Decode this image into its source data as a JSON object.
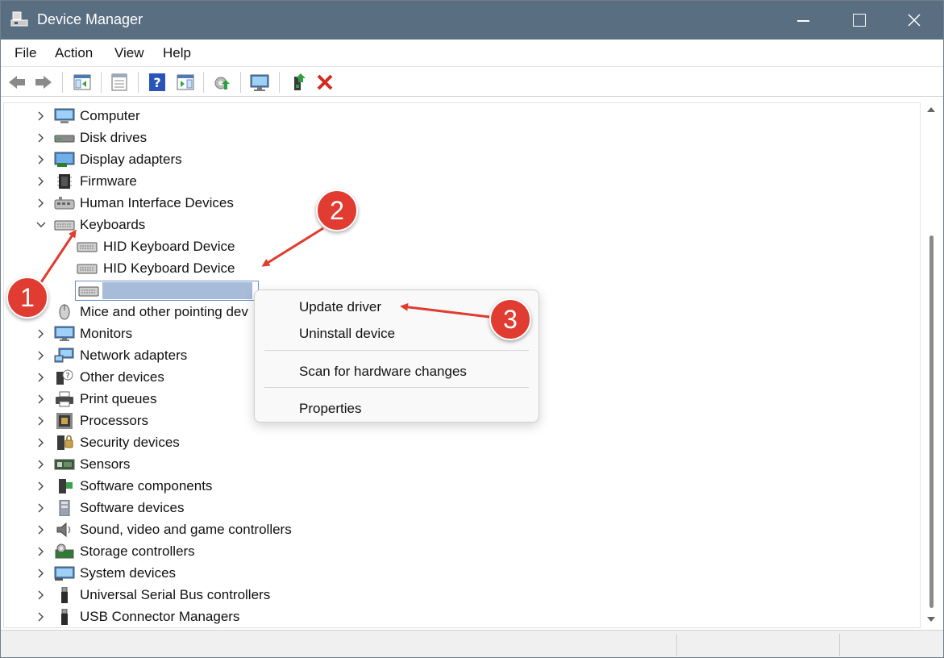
{
  "window": {
    "title": "Device Manager"
  },
  "menu": [
    "File",
    "Action",
    "View",
    "Help"
  ],
  "toolbar": {
    "buttons": [
      "back-icon",
      "forward-icon",
      "console-tree-icon",
      "properties-sheet-icon",
      "help-icon",
      "action-pane-icon",
      "update-driver-icon",
      "scan-hardware-icon",
      "add-driver-icon",
      "uninstall-device-icon"
    ]
  },
  "tree": {
    "items": [
      {
        "label": "Computer",
        "icon": "computer-icon"
      },
      {
        "label": "Disk drives",
        "icon": "disk-drive-icon"
      },
      {
        "label": "Display adapters",
        "icon": "display-adapter-icon"
      },
      {
        "label": "Firmware",
        "icon": "firmware-icon"
      },
      {
        "label": "Human Interface Devices",
        "icon": "hid-icon"
      },
      {
        "label": "Keyboards",
        "icon": "keyboard-icon",
        "expanded": true
      },
      {
        "label": "HID Keyboard Device",
        "icon": "keyboard-icon",
        "child": true
      },
      {
        "label": "HID Keyboard Device",
        "icon": "keyboard-icon",
        "child": true
      },
      {
        "label": "",
        "icon": "keyboard-icon",
        "child": true,
        "selected": true
      },
      {
        "label": "Mice and other pointing dev",
        "icon": "mouse-icon"
      },
      {
        "label": "Monitors",
        "icon": "monitor-icon"
      },
      {
        "label": "Network adapters",
        "icon": "network-adapter-icon"
      },
      {
        "label": "Other devices",
        "icon": "other-devices-icon"
      },
      {
        "label": "Print queues",
        "icon": "printer-icon"
      },
      {
        "label": "Processors",
        "icon": "processor-icon"
      },
      {
        "label": "Security devices",
        "icon": "security-device-icon"
      },
      {
        "label": "Sensors",
        "icon": "sensor-icon"
      },
      {
        "label": "Software components",
        "icon": "software-component-icon"
      },
      {
        "label": "Software devices",
        "icon": "software-device-icon"
      },
      {
        "label": "Sound, video and game controllers",
        "icon": "speaker-icon"
      },
      {
        "label": "Storage controllers",
        "icon": "storage-controller-icon"
      },
      {
        "label": "System devices",
        "icon": "system-device-icon"
      },
      {
        "label": "Universal Serial Bus controllers",
        "icon": "usb-icon"
      },
      {
        "label": "USB Connector Managers",
        "icon": "usb-icon"
      }
    ]
  },
  "context_menu": {
    "update_driver": "Update driver",
    "uninstall_device": "Uninstall device",
    "scan": "Scan for hardware changes",
    "properties": "Properties"
  },
  "annotations": {
    "one": "1",
    "two": "2",
    "three": "3"
  },
  "colors": {
    "titlebar": "#5a6e82",
    "annotation": "#e03c31",
    "selection": "#a7bcd9"
  }
}
